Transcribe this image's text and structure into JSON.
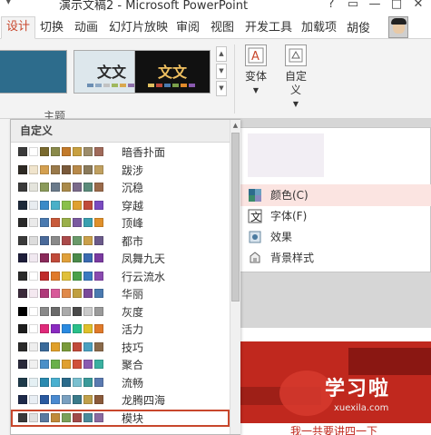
{
  "window": {
    "title": "演示文稿2 - Microsoft PowerPoint",
    "controls": [
      "?",
      "▭",
      "—",
      "□",
      "✕"
    ]
  },
  "tabs": [
    {
      "label": "设计",
      "active": true
    },
    {
      "label": "切换"
    },
    {
      "label": "动画"
    },
    {
      "label": "幻灯片放映"
    },
    {
      "label": "审阅"
    },
    {
      "label": "视图"
    },
    {
      "label": "开发工具"
    },
    {
      "label": "加载项"
    }
  ],
  "user": {
    "name": "胡俊"
  },
  "ribbon": {
    "group_label": "主题",
    "themes": [
      {
        "text": "",
        "bg": "#2d6c8c",
        "fg": "#ffffff"
      },
      {
        "text": "文文",
        "bg": "#dde7ec",
        "fg": "#2a2a2a"
      },
      {
        "text": "文文",
        "bg": "#111111",
        "fg": "#f0c060"
      }
    ],
    "variant_button": "变体",
    "custom_button": "自定义"
  },
  "variant_menu": {
    "items": [
      {
        "label": "颜色(C)",
        "icon": "color-swatch-icon",
        "hover": true
      },
      {
        "label": "字体(F)",
        "icon": "font-icon"
      },
      {
        "label": "效果",
        "icon": "effects-icon"
      },
      {
        "label": "背景样式",
        "icon": "background-style-icon"
      }
    ]
  },
  "color_popup": {
    "header": "自定义",
    "schemes": [
      {
        "name": "暗香扑面",
        "colors": [
          "#3b3b3b",
          "#ffffff",
          "#7a6a2e",
          "#8a8a4a",
          "#c27a2a",
          "#c8a040",
          "#9c8c6a",
          "#a06a5a"
        ]
      },
      {
        "name": "跋涉",
        "colors": [
          "#2e2a24",
          "#f0e4cc",
          "#d4a050",
          "#9a7a4a",
          "#7a5a3a",
          "#b88a4a",
          "#8a7a5a",
          "#c0a060"
        ]
      },
      {
        "name": "沉稳",
        "colors": [
          "#3a3a3a",
          "#e4e4dc",
          "#8a9a5a",
          "#6a7a8a",
          "#aa8a4a",
          "#7a6a8a",
          "#5a8a7a",
          "#9a6a4a"
        ]
      },
      {
        "name": "穿越",
        "colors": [
          "#1e2a3a",
          "#e8ecf0",
          "#3a8ac8",
          "#4ab0c8",
          "#8ac04a",
          "#e0a030",
          "#c04a3a",
          "#7a4ac0"
        ]
      },
      {
        "name": "顶峰",
        "colors": [
          "#2a2a2a",
          "#eaeaea",
          "#4a7ab0",
          "#c85a3a",
          "#9ab04a",
          "#7a5aa0",
          "#3aa0b0",
          "#e0902a"
        ]
      },
      {
        "name": "都市",
        "colors": [
          "#3a3a3a",
          "#dcdcdc",
          "#4a6a9a",
          "#8a8a8a",
          "#aa4a4a",
          "#6a9a6a",
          "#caa04a",
          "#6a5a8a"
        ]
      },
      {
        "name": "凤舞九天",
        "colors": [
          "#1e1e3a",
          "#f0e8f0",
          "#8a2a5a",
          "#c04a3a",
          "#e0a03a",
          "#4a8a4a",
          "#3a6ab0",
          "#7a3aa0"
        ]
      },
      {
        "name": "行云流水",
        "colors": [
          "#2a2a2a",
          "#ffffff",
          "#c02a2a",
          "#e07a2a",
          "#e0c03a",
          "#4aa04a",
          "#3a7ac0",
          "#8a4ab0"
        ]
      },
      {
        "name": "华丽",
        "colors": [
          "#3a2a3a",
          "#f4e8f0",
          "#b03a7a",
          "#d85a9a",
          "#e08a4a",
          "#c0a040",
          "#7a4a9a",
          "#4a7ab0"
        ]
      },
      {
        "name": "灰度",
        "colors": [
          "#000000",
          "#ffffff",
          "#8a8a8a",
          "#6a6a6a",
          "#aaaaaa",
          "#4a4a4a",
          "#cacaca",
          "#9a9a9a"
        ]
      },
      {
        "name": "活力",
        "colors": [
          "#1e1e1e",
          "#ffffff",
          "#e02a7a",
          "#8a2ac0",
          "#2a8ae0",
          "#2ac08a",
          "#e0c02a",
          "#e07a2a"
        ]
      },
      {
        "name": "技巧",
        "colors": [
          "#2a2a2a",
          "#eeeeee",
          "#3a6a9a",
          "#e0a02a",
          "#7a9a3a",
          "#c04a3a",
          "#4aa0c0",
          "#8a6a4a"
        ]
      },
      {
        "name": "聚合",
        "colors": [
          "#2a2a3a",
          "#f0f0f0",
          "#4a90c8",
          "#6ab04a",
          "#e0a030",
          "#d0503a",
          "#8a5ab0",
          "#3ab0a0"
        ]
      },
      {
        "name": "流畅",
        "colors": [
          "#1e3a4a",
          "#e4f0f4",
          "#2a8ab0",
          "#4ab0d0",
          "#2a6a8a",
          "#7ac0d0",
          "#3a9a9a",
          "#5a7ab0"
        ]
      },
      {
        "name": "龙腾四海",
        "colors": [
          "#1e2a4a",
          "#e8eef4",
          "#2a5aa0",
          "#4a8ad0",
          "#7aa0c0",
          "#3a7a8a",
          "#c0a04a",
          "#8a5a3a"
        ]
      },
      {
        "name": "模块",
        "colors": [
          "#3a3a3a",
          "#e0e0e0",
          "#5a7aa0",
          "#c08a3a",
          "#7aa05a",
          "#a04a4a",
          "#4a8a9a",
          "#8a6aa0"
        ]
      }
    ]
  },
  "watermark": {
    "brand": "学习啦",
    "url": "xuexila.com",
    "bottom_text": "我一共要讲四一下"
  }
}
